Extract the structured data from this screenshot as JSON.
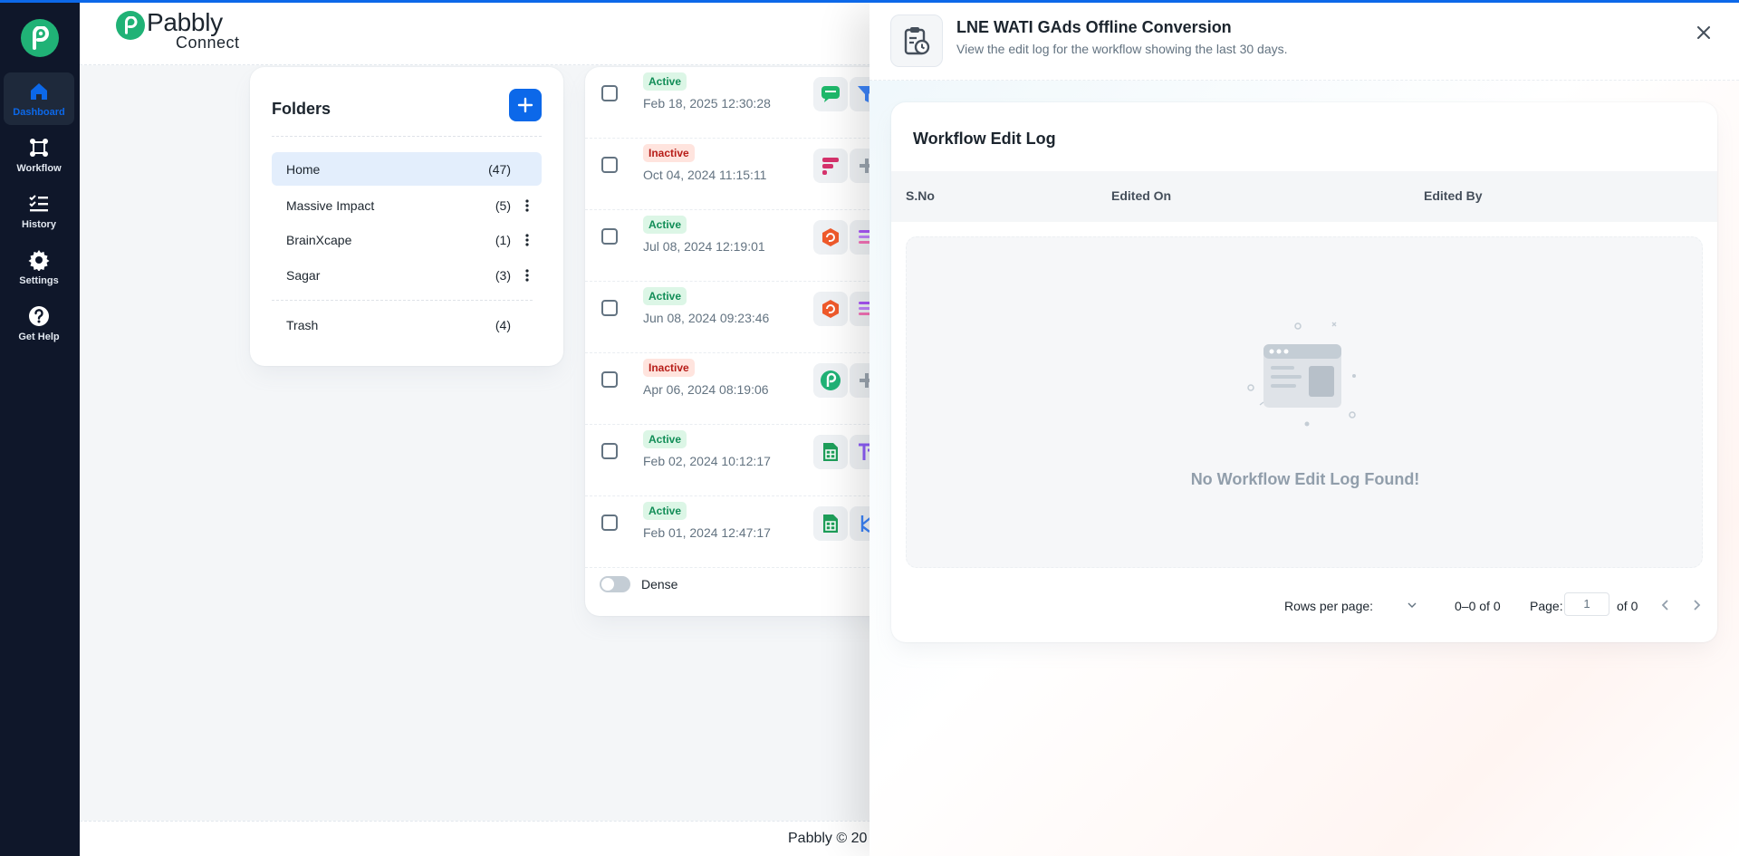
{
  "nav": {
    "items": [
      {
        "label": "Dashboard",
        "icon": "home-icon"
      },
      {
        "label": "Workflow",
        "icon": "workflow-icon"
      },
      {
        "label": "History",
        "icon": "history-icon"
      },
      {
        "label": "Settings",
        "icon": "gear-icon"
      },
      {
        "label": "Get Help",
        "icon": "help-icon"
      }
    ],
    "active": "Dashboard"
  },
  "brand": {
    "name": "Pabbly",
    "sub": "Connect",
    "color": "#20b276"
  },
  "folders": {
    "title": "Folders",
    "items": [
      {
        "name": "Home",
        "count": "(47)",
        "selected": true
      },
      {
        "name": "Massive Impact",
        "count": "(5)"
      },
      {
        "name": "BrainXcape",
        "count": "(1)"
      },
      {
        "name": "Sagar",
        "count": "(3)"
      },
      {
        "name": "Trash",
        "count": "(4)"
      }
    ]
  },
  "workflows": {
    "rows": [
      {
        "status": "Active",
        "date": "Feb 18, 2025 12:30:28",
        "apps": [
          "chat-icon",
          "filter-icon"
        ]
      },
      {
        "status": "Inactive",
        "date": "Oct 04, 2024 11:15:11",
        "apps": [
          "fields-icon",
          "plus-icon"
        ]
      },
      {
        "status": "Active",
        "date": "Jul 08, 2024 12:19:01",
        "apps": [
          "g-app-icon",
          "stack-icon"
        ]
      },
      {
        "status": "Active",
        "date": "Jun 08, 2024 09:23:46",
        "apps": [
          "g-app-icon",
          "stack-icon"
        ]
      },
      {
        "status": "Inactive",
        "date": "Apr 06, 2024 08:19:06",
        "apps": [
          "pabbly-icon",
          "plus-icon"
        ]
      },
      {
        "status": "Active",
        "date": "Feb 02, 2024 10:12:17",
        "apps": [
          "sheets-icon",
          "text-icon"
        ]
      },
      {
        "status": "Active",
        "date": "Feb 01, 2024 12:47:17",
        "apps": [
          "sheets-icon",
          "branch-icon"
        ]
      }
    ],
    "dense_label": "Dense"
  },
  "footer": {
    "text": "Pabbly © 20"
  },
  "drawer": {
    "title": "LNE WATI GAds Offline Conversion",
    "subtitle": "View the edit log for the workflow showing the last 30 days.",
    "card_title": "Workflow Edit Log",
    "columns": [
      "S.No",
      "Edited On",
      "Edited By"
    ],
    "empty_text": "No Workflow Edit Log Found!",
    "pager": {
      "rows_per_page": "Rows per page:",
      "range": "0–0 of 0",
      "page_label": "Page:",
      "page_value": "1",
      "of_pages": "of 0"
    }
  }
}
